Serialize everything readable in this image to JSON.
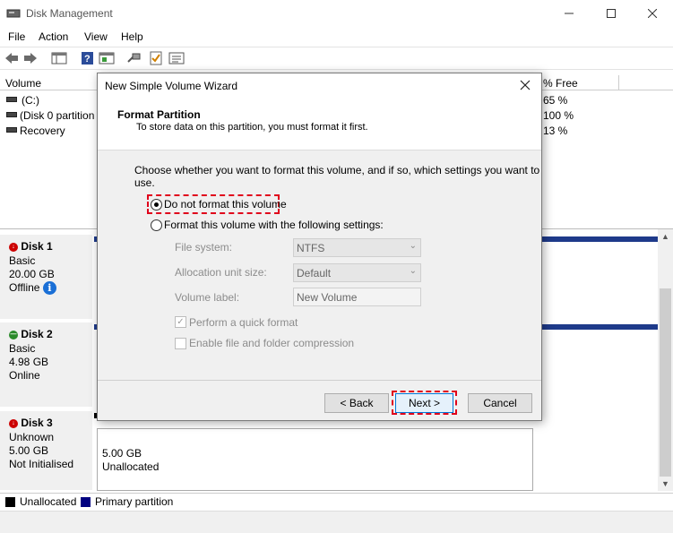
{
  "window": {
    "title": "Disk Management"
  },
  "menu": [
    "File",
    "Action",
    "View",
    "Help"
  ],
  "volume_list": {
    "columns": {
      "volume": "Volume",
      "free_pct": "% Free"
    },
    "rows": [
      {
        "name": "(C:)",
        "free": "65 %"
      },
      {
        "name": "(Disk 0 partition",
        "free": "100 %"
      },
      {
        "name": "Recovery",
        "free": "13 %"
      }
    ]
  },
  "disks": [
    {
      "title": "Disk 1",
      "type": "Basic",
      "size": "20.00 GB",
      "status": "Offline"
    },
    {
      "title": "Disk 2",
      "type": "Basic",
      "size": "4.98 GB",
      "status": "Online"
    },
    {
      "title": "Disk 3",
      "type": "Unknown",
      "size": "5.00 GB",
      "status": "Not Initialised"
    }
  ],
  "disk3_partition": {
    "size": "5.00 GB",
    "label": "Unallocated"
  },
  "legend": {
    "unallocated": "Unallocated",
    "primary": "Primary partition"
  },
  "colors": {
    "unallocated": "#000000",
    "primary": "#000080",
    "highlight": "#e0001b",
    "partition_bar": "#1e3a8a"
  },
  "dialog": {
    "title": "New Simple Volume Wizard",
    "heading": "Format Partition",
    "subheading": "To store data on this partition, you must format it first.",
    "instruction": "Choose whether you want to format this volume, and if so, which settings you want to use.",
    "option_no_format": "Do not format this volume",
    "option_format": "Format this volume with the following settings:",
    "file_system_label": "File system:",
    "file_system_value": "NTFS",
    "alloc_label": "Allocation unit size:",
    "alloc_value": "Default",
    "volume_label_label": "Volume label:",
    "volume_label_value": "New Volume",
    "quick_format": "Perform a quick format",
    "compression": "Enable file and folder compression",
    "back": "< Back",
    "next": "Next >",
    "cancel": "Cancel",
    "selected_option": "no_format"
  }
}
